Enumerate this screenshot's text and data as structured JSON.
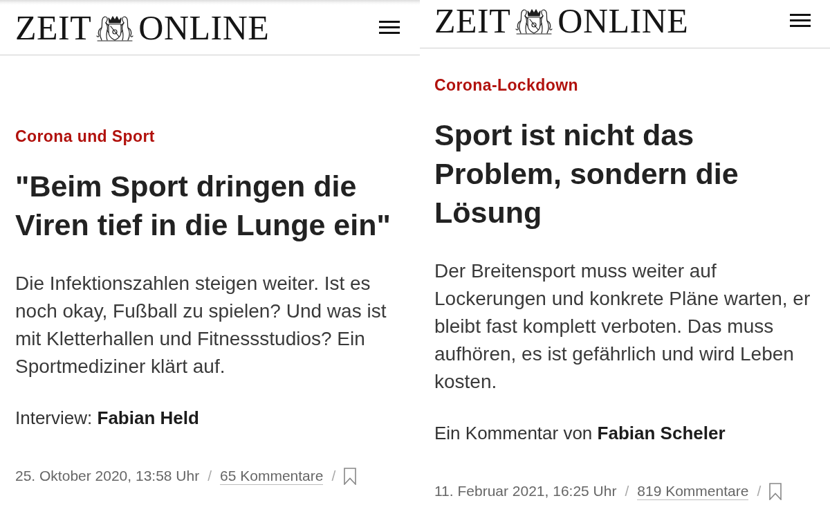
{
  "articles": [
    {
      "header": {
        "logo": {
          "left_word": "ZEIT",
          "right_word": "ONLINE"
        }
      },
      "kicker": "Corona und Sport",
      "title": "\"Beim Sport dringen die Viren tief in die Lunge ein\"",
      "intro": "Die Infektionszahlen steigen weiter. Ist es noch okay, Fußball zu spielen? Und was ist mit Kletterhallen und Fitnessstudios? Ein Sportmediziner klärt auf.",
      "byline": "Interview: **Fabian Held**",
      "meta": [
        {
          "kind": "date",
          "text": "25. Oktober 2020, 13:58 Uhr"
        },
        {
          "kind": "separator",
          "text": "/"
        },
        {
          "kind": "link",
          "text": "65 Kommentare"
        },
        {
          "kind": "separator",
          "text": "/"
        },
        {
          "kind": "bookmark"
        }
      ]
    },
    {
      "header": {
        "logo": {
          "left_word": "ZEIT",
          "right_word": "ONLINE"
        }
      },
      "kicker": "Corona-Lockdown",
      "title": "Sport ist nicht das Problem, sondern die Lösung",
      "intro": "Der Breitensport muss weiter auf Lockerungen und konkrete Pläne warten, er bleibt fast komplett verboten. Das muss aufhören, es ist gefährlich und wird Leben kosten.",
      "byline": "Ein Kommentar von **Fabian Scheler**",
      "meta": [
        {
          "kind": "date",
          "text": "11. Februar 2021, 16:25 Uhr"
        },
        {
          "kind": "separator",
          "text": "/"
        },
        {
          "kind": "link",
          "text": "819 Kommentare"
        },
        {
          "kind": "separator",
          "text": "/"
        },
        {
          "kind": "bookmark"
        }
      ]
    }
  ]
}
